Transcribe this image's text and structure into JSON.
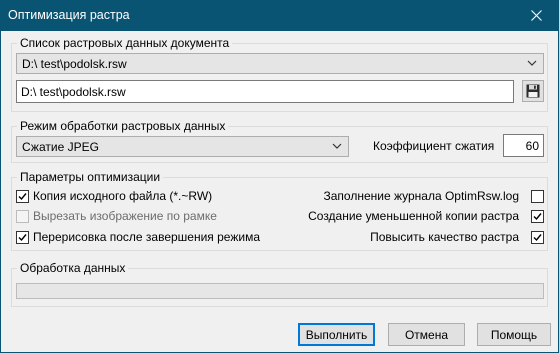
{
  "window": {
    "title": "Оптимизация растра"
  },
  "raster_list": {
    "legend": "Список растровых данных документа",
    "selected": "D:\\ test\\podolsk.rsw",
    "path_value": "D:\\ test\\podolsk.rsw",
    "save_icon": "floppy-disk-icon"
  },
  "mode": {
    "legend": "Режим обработки растровых данных",
    "selected": "Сжатие JPEG",
    "ratio_label": "Коэффициент сжатия",
    "ratio_value": "60"
  },
  "options": {
    "legend": "Параметры оптимизации",
    "copy_source": {
      "label": "Копия исходного файла (*.~RW)",
      "checked": true,
      "enabled": true
    },
    "crop_frame": {
      "label": "Вырезать изображение по рамке",
      "checked": false,
      "enabled": false
    },
    "redraw": {
      "label": "Перерисовка после завершения режима",
      "checked": true,
      "enabled": true
    },
    "log": {
      "label": "Заполнение журнала OptimRsw.log",
      "checked": false,
      "enabled": true
    },
    "reduced_copy": {
      "label": "Создание уменьшенной копии растра",
      "checked": true,
      "enabled": true
    },
    "quality": {
      "label": "Повысить качество растра",
      "checked": true,
      "enabled": true
    }
  },
  "processing": {
    "legend": "Обработка данных",
    "progress": 0
  },
  "buttons": {
    "run": "Выполнить",
    "cancel": "Отмена",
    "help": "Помощь"
  },
  "colors": {
    "titlebar": "#0a5473",
    "accent": "#0078d7"
  }
}
